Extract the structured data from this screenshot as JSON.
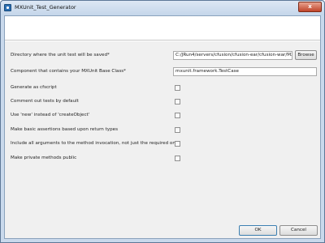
{
  "window": {
    "title": "MXUnit_Test_Generator",
    "close_glyph": "x",
    "accent_color": "#c0442a"
  },
  "form": {
    "directory": {
      "label": "Directory where the unit test will be saved*",
      "value": "C:/JRun4/servers/cfusion/cfusion-ear/cfusion-war/MX",
      "browse_label": "Browse"
    },
    "base_class": {
      "label": "Component that contains your MXUnit Base Class*",
      "value": "mxunit.framework.TestCase"
    },
    "options": [
      {
        "label": "Generate as cfscript",
        "checked": false
      },
      {
        "label": "Comment out tests by default",
        "checked": false
      },
      {
        "label": "Use 'new' instead of 'createObject'",
        "checked": false
      },
      {
        "label": "Make basic assertions based upon return types",
        "checked": false
      },
      {
        "label": "Include all arguments to the method invocation, not just the required ones",
        "checked": false
      },
      {
        "label": "Make private methods public",
        "checked": false
      }
    ]
  },
  "buttons": {
    "ok": "OK",
    "cancel": "Cancel"
  }
}
